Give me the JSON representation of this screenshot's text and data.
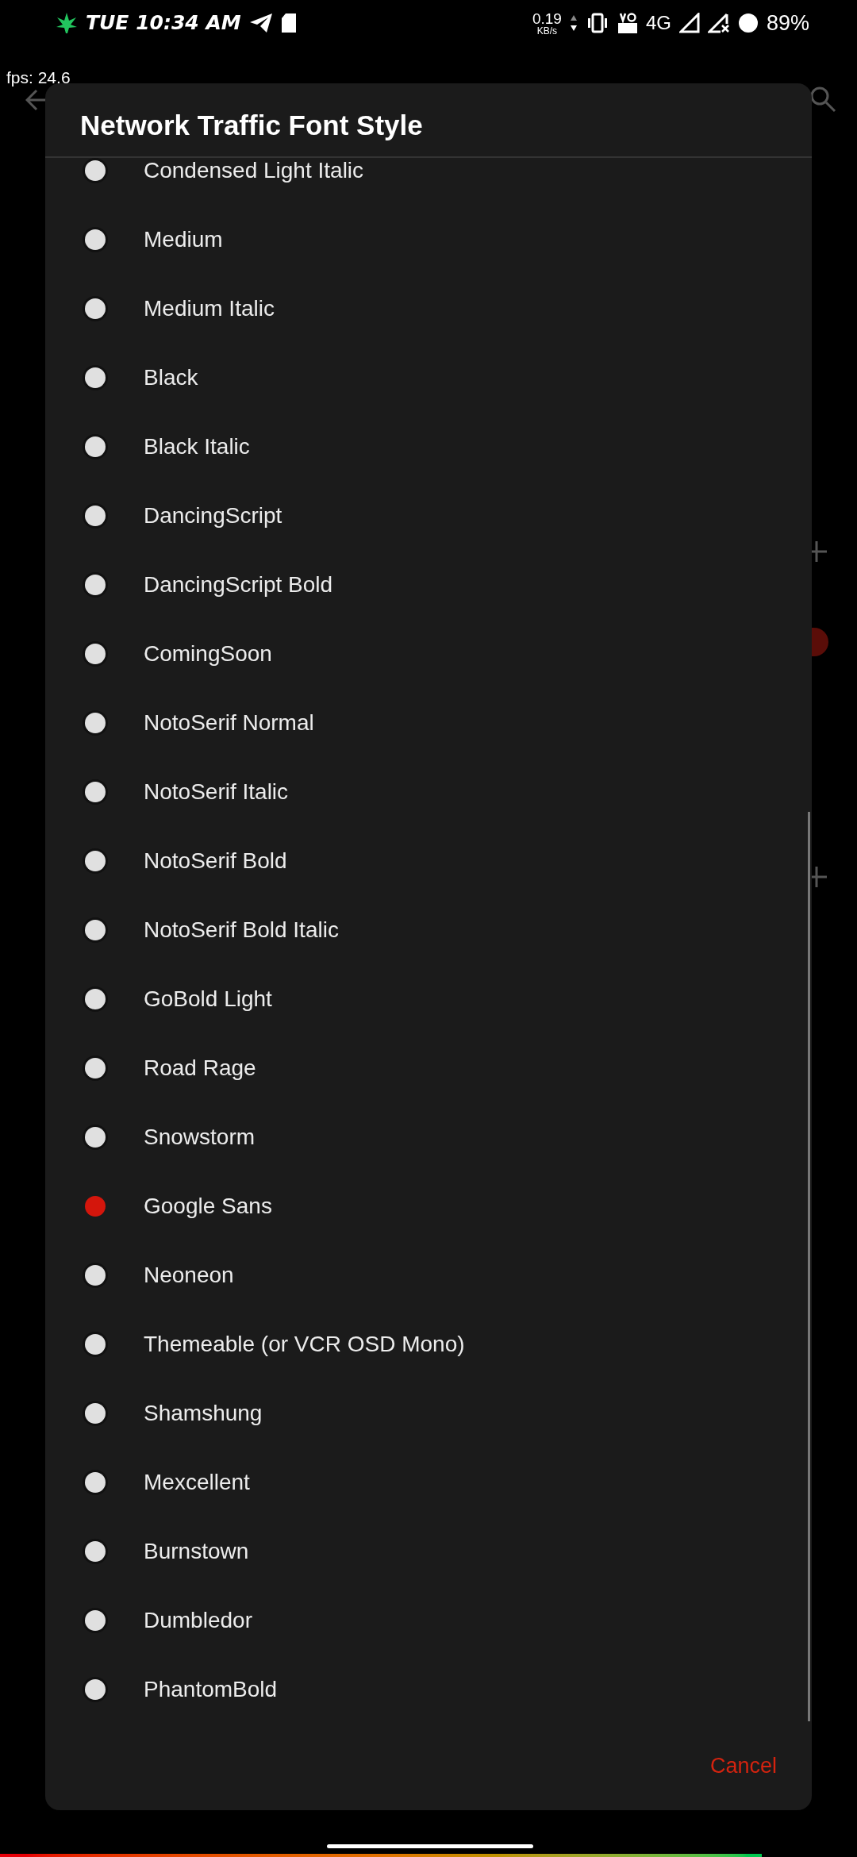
{
  "status_bar": {
    "time": "TUE 10:34 AM",
    "net_speed": "0.19",
    "net_unit": "KB/s",
    "network": "4G",
    "battery": "89%"
  },
  "overlay": {
    "fps": "fps: 24.6"
  },
  "dialog": {
    "title": "Network Traffic Font Style",
    "options": [
      {
        "label": "Condensed Light Italic",
        "selected": false
      },
      {
        "label": "Medium",
        "selected": false
      },
      {
        "label": "Medium Italic",
        "selected": false
      },
      {
        "label": "Black",
        "selected": false
      },
      {
        "label": "Black Italic",
        "selected": false
      },
      {
        "label": "DancingScript",
        "selected": false
      },
      {
        "label": "DancingScript Bold",
        "selected": false
      },
      {
        "label": "ComingSoon",
        "selected": false
      },
      {
        "label": "NotoSerif Normal",
        "selected": false
      },
      {
        "label": "NotoSerif Italic",
        "selected": false
      },
      {
        "label": "NotoSerif Bold",
        "selected": false
      },
      {
        "label": "NotoSerif Bold Italic",
        "selected": false
      },
      {
        "label": "GoBold Light",
        "selected": false
      },
      {
        "label": "Road Rage",
        "selected": false
      },
      {
        "label": "Snowstorm",
        "selected": false
      },
      {
        "label": "Google Sans",
        "selected": true
      },
      {
        "label": "Neoneon",
        "selected": false
      },
      {
        "label": "Themeable (or VCR OSD Mono)",
        "selected": false
      },
      {
        "label": "Shamshung",
        "selected": false
      },
      {
        "label": "Mexcellent",
        "selected": false
      },
      {
        "label": "Burnstown",
        "selected": false
      },
      {
        "label": "Dumbledor",
        "selected": false
      },
      {
        "label": "PhantomBold",
        "selected": false
      }
    ],
    "cancel": "Cancel"
  }
}
